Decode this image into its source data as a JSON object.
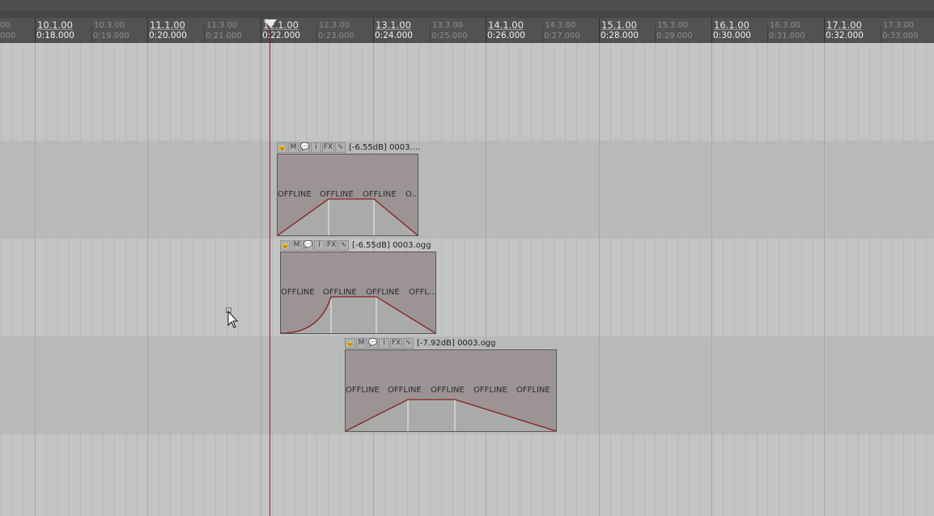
{
  "colors": {
    "background": "#c3c5c5",
    "ruler": "#525252",
    "playhead": "#8e1e1e",
    "item_fill": "#9c9494",
    "envelope": "#8b1c1c"
  },
  "ruler": {
    "labels": [
      {
        "beat": "10.1.00",
        "time": "0:18.000",
        "major": true
      },
      {
        "beat": "10.3.00",
        "time": "0:19.000",
        "major": false
      },
      {
        "beat": "11.1.00",
        "time": "0:20.000",
        "major": true
      },
      {
        "beat": "11.3.00",
        "time": "0:21.000",
        "major": false
      },
      {
        "beat": "12.1.00",
        "time": "0:22.000",
        "major": true
      },
      {
        "beat": "12.3.00",
        "time": "0:23.000",
        "major": false
      },
      {
        "beat": "13.1.00",
        "time": "0:24.000",
        "major": true
      },
      {
        "beat": "13.3.00",
        "time": "0:25.000",
        "major": false
      },
      {
        "beat": "14.1.00",
        "time": "0:26.000",
        "major": true
      },
      {
        "beat": "14.3.00",
        "time": "0:27.000",
        "major": false
      },
      {
        "beat": "15.1.00",
        "time": "0:28.000",
        "major": true
      },
      {
        "beat": "15.3.00",
        "time": "0:29.000",
        "major": false
      },
      {
        "beat": "16.1.00",
        "time": "0:30.000",
        "major": true
      },
      {
        "beat": "16.3.00",
        "time": "0:31.000",
        "major": false
      },
      {
        "beat": "17.1.00",
        "time": "0:32.000",
        "major": true
      },
      {
        "beat": "17.3.00",
        "time": "0:33.000",
        "major": false
      }
    ],
    "left_partial": {
      "beat": "00",
      "time": "000"
    }
  },
  "item_buttons": {
    "lock": "🔒",
    "mute": "M",
    "notes": "💬",
    "info": "i",
    "fx": "FX",
    "envelope": "∿"
  },
  "items": [
    {
      "name": "[-6.55dB] 0003....",
      "offline_labels": [
        "OFFLINE",
        "OFFLINE",
        "OFFLINE",
        "O..."
      ]
    },
    {
      "name": "[-6.55dB] 0003.ogg",
      "offline_labels": [
        "OFFLINE",
        "OFFLINE",
        "OFFLINE",
        "OFFL..."
      ]
    },
    {
      "name": "[-7.92dB] 0003.ogg",
      "offline_labels": [
        "OFFLINE",
        "OFFLINE",
        "OFFLINE",
        "OFFLINE",
        "OFFLINE"
      ]
    }
  ]
}
